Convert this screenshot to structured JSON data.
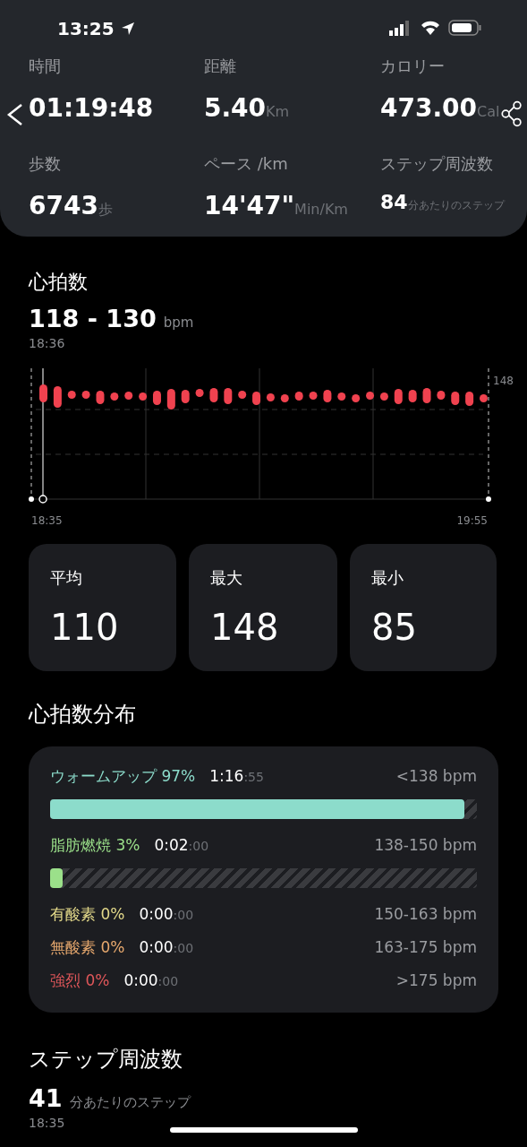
{
  "status_bar": {
    "time": "13:25"
  },
  "summary": [
    {
      "label": "時間",
      "value": "01:19:48"
    },
    {
      "label": "距離",
      "value": "5.40",
      "unit": "Km"
    },
    {
      "label": "カロリー",
      "value": "473.00",
      "unit": "Cal"
    },
    {
      "label": "歩数",
      "value": "6743",
      "unit": "歩"
    },
    {
      "label": "ペース /km",
      "value": "14'47\"",
      "unit": "Min/Km"
    },
    {
      "label": "ステップ周波数",
      "value": "84",
      "unit": "分あたりのステップ"
    }
  ],
  "heart_rate": {
    "title": "心拍数",
    "range": "118 - 130",
    "unit": "bpm",
    "time": "18:36",
    "y_label": "148",
    "x_start": "18:35",
    "x_end": "19:55"
  },
  "stats": [
    {
      "label": "平均",
      "value": "110"
    },
    {
      "label": "最大",
      "value": "148"
    },
    {
      "label": "最小",
      "value": "85"
    }
  ],
  "zones_title": "心拍数分布",
  "zones": [
    {
      "name": "ウォームアップ 97%",
      "time": "1:16",
      "seconds": ":55",
      "range": "<138 bpm",
      "color": "#8cdccb",
      "level": 0.97
    },
    {
      "name": "脂肪燃焼 3%",
      "time": "0:02",
      "seconds": ":00",
      "range": "138-150 bpm",
      "color": "#9be08a",
      "level": 0.03
    },
    {
      "name": "有酸素 0%",
      "time": "0:00",
      "seconds": ":00",
      "range": "150-163 bpm",
      "color": "#e3d98a"
    },
    {
      "name": "無酸素 0%",
      "time": "0:00",
      "seconds": ":00",
      "range": "163-175 bpm",
      "color": "#e8a96e"
    },
    {
      "name": "強烈 0%",
      "time": "0:00",
      "seconds": ":00",
      "range": ">175 bpm",
      "color": "#e0575a"
    }
  ],
  "cadence": {
    "title": "ステップ周波数",
    "value": "41",
    "unit": "分あたりのステップ",
    "time": "18:35"
  }
}
